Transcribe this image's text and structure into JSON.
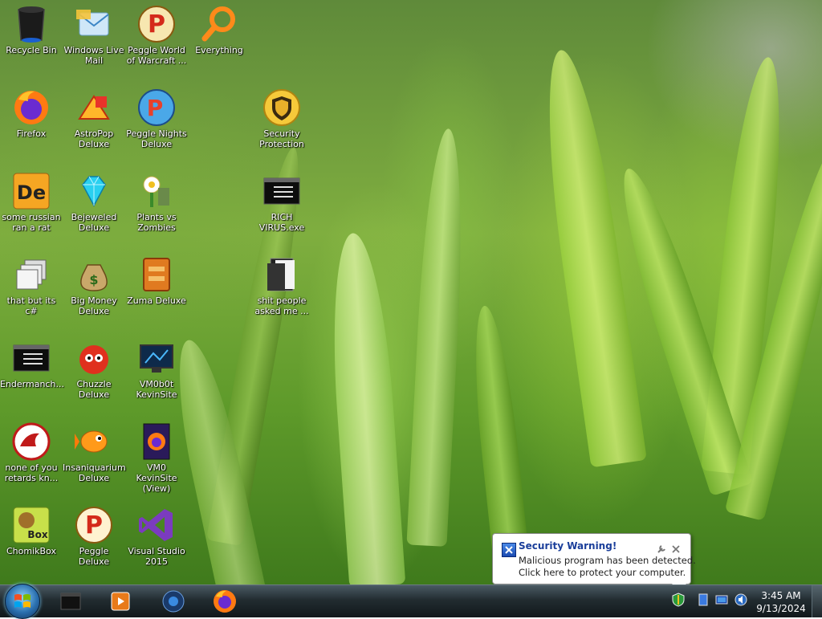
{
  "desktop": {
    "icons": [
      {
        "id": "recycle-bin",
        "label": "Recycle Bin"
      },
      {
        "id": "windows-live-mail",
        "label": "Windows Live Mail"
      },
      {
        "id": "peggle-wow",
        "label": "Peggle World of Warcraft ..."
      },
      {
        "id": "everything",
        "label": "Everything"
      },
      {
        "id": "firefox",
        "label": "Firefox"
      },
      {
        "id": "astropop",
        "label": "AstroPop Deluxe"
      },
      {
        "id": "peggle-nights",
        "label": "Peggle Nights Deluxe"
      },
      {
        "id": "security-protection",
        "label": "Security Protection"
      },
      {
        "id": "some-russian",
        "label": "some russian ran a rat"
      },
      {
        "id": "bejeweled",
        "label": "Bejeweled Deluxe"
      },
      {
        "id": "pvz",
        "label": "Plants vs Zombies"
      },
      {
        "id": "rich-virus",
        "label": "RICH VIRUS.exe"
      },
      {
        "id": "that-but-csharp",
        "label": "that but its c#"
      },
      {
        "id": "big-money",
        "label": "Big Money Deluxe"
      },
      {
        "id": "zuma",
        "label": "Zuma Deluxe"
      },
      {
        "id": "shit-people",
        "label": "shit people asked me ..."
      },
      {
        "id": "endermanch",
        "label": "Endermanch..."
      },
      {
        "id": "chuzzle",
        "label": "Chuzzle Deluxe"
      },
      {
        "id": "vm0b0t",
        "label": "VM0b0t KevinSite"
      },
      {
        "id": "none-of-you",
        "label": "none of you retards kn..."
      },
      {
        "id": "insaniquarium",
        "label": "Insaniquarium Deluxe"
      },
      {
        "id": "vm0-kevinsite-view",
        "label": "VM0 KevinSite (View)"
      },
      {
        "id": "chomikbox",
        "label": "ChomikBox"
      },
      {
        "id": "peggle-deluxe",
        "label": "Peggle Deluxe"
      },
      {
        "id": "visual-studio",
        "label": "Visual Studio 2015"
      }
    ]
  },
  "balloon": {
    "title": "Security Warning!",
    "line1": "Malicious program has been detected.",
    "line2": "Click here to protect your computer."
  },
  "taskbar": {
    "pinned": [
      "terminal-icon",
      "media-player-icon",
      "media-center-icon",
      "firefox-icon"
    ],
    "clock": {
      "time": "3:45 AM",
      "date": "9/13/2024"
    }
  },
  "colors": {
    "balloon_title": "#1a3e9a",
    "firefox_orange": "#ff7a12",
    "taskbar": "#1c2428"
  }
}
